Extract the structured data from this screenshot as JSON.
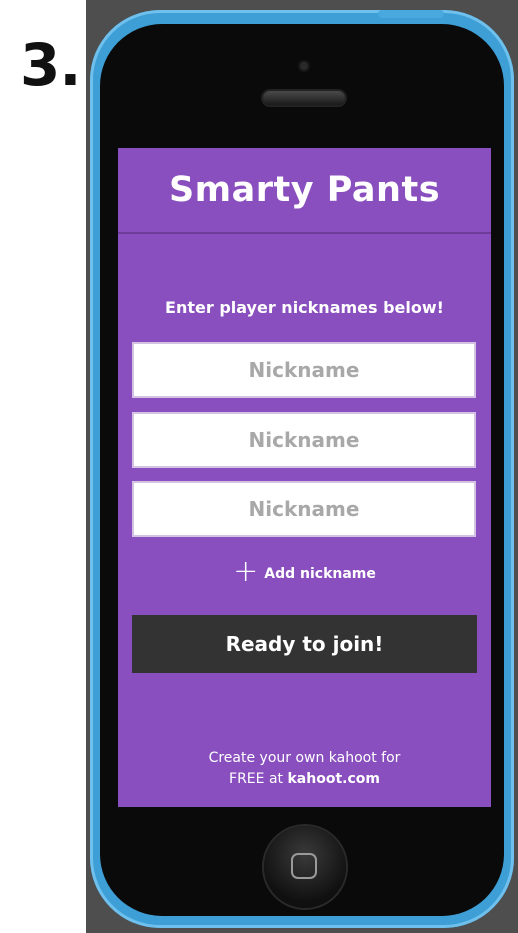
{
  "step": {
    "label": "3."
  },
  "app": {
    "title": "Smarty Pants",
    "prompt": "Enter player nicknames below!",
    "nickname_inputs": [
      {
        "placeholder": "Nickname",
        "value": ""
      },
      {
        "placeholder": "Nickname",
        "value": ""
      },
      {
        "placeholder": "Nickname",
        "value": ""
      }
    ],
    "add_nickname": {
      "icon": "plus-icon",
      "label": "Add nickname"
    },
    "join_button": {
      "label": "Ready to join!"
    },
    "footer": {
      "line1": "Create your own kahoot for",
      "line2_prefix": "FREE at ",
      "line2_link": "kahoot.com"
    }
  },
  "colors": {
    "screen_bg": "#8a4fbe",
    "phone_shell": "#3d9fd6",
    "button_bg": "#333333"
  }
}
